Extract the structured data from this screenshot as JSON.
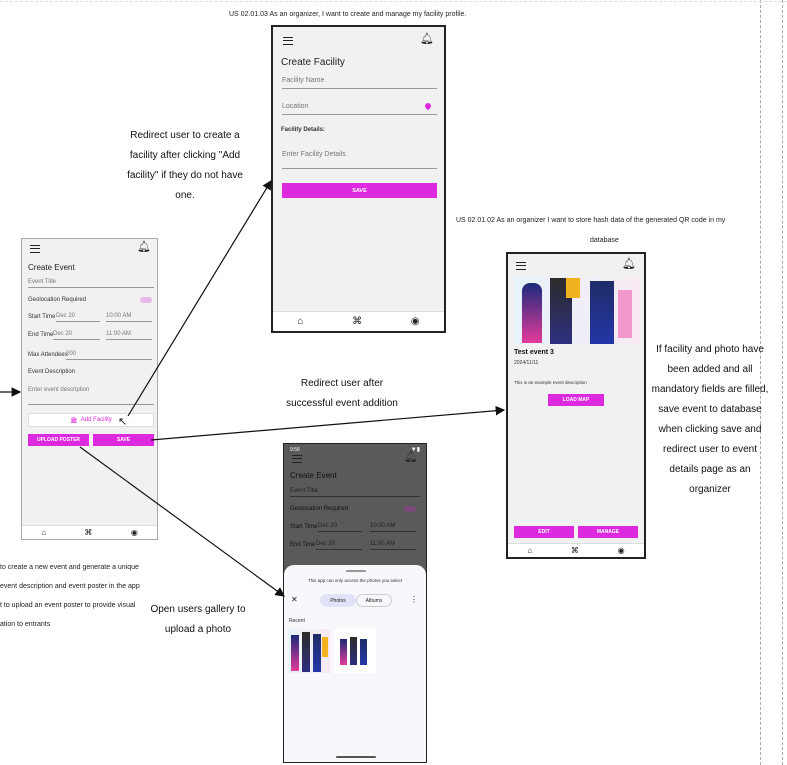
{
  "stories": {
    "facility": "US 02.01.03 As an organizer, I want to create and manage my facility profile.",
    "qr": "US 02.01.02 As an organizer I want to store hash data of the generated QR code in my",
    "qr_line2": "database"
  },
  "notes": {
    "redirect_facility": [
      "Redirect user to create a",
      "facility after clicking \"Add",
      "facility\" if they do not have",
      "one."
    ],
    "redirect_success": [
      "Redirect user after",
      "successful event addition"
    ],
    "gallery": [
      "Open users gallery to",
      "upload a photo"
    ],
    "save_rule": [
      "If facility and photo have",
      "been added and all",
      "mandatory fields are filled,",
      "save event to database",
      "when clicking save and",
      "redirect user to event",
      "details page as an",
      "organizer"
    ],
    "left_desc": [
      "to create a new event and generate a unique",
      "event description and event poster in the app",
      "t to upload an event poster to provide visual",
      "ation to entrants"
    ]
  },
  "facility_screen": {
    "title": "Create Facility",
    "name_placeholder": "Facility Name",
    "location_placeholder": "Location",
    "details_label": "Facility Details:",
    "details_placeholder": "Enter Facility Details",
    "save": "SAVE"
  },
  "event_screen": {
    "title": "Create Event",
    "event_title": "Event Title",
    "geolocation": "Geolocation Required",
    "start_label": "Start Time",
    "start_date": "Dec 20",
    "start_time": "10:00 AM",
    "end_label": "End Time",
    "end_date": "Dec 20",
    "end_time": "11:00 AM",
    "max_label": "Max Attendees",
    "max_value": "200",
    "desc_label": "Event Description",
    "desc_placeholder": "Enter event description",
    "add_facility": "Add Facility",
    "upload": "UPLOAD POSTER",
    "save": "SAVE"
  },
  "details_screen": {
    "event_name": "Test event 3",
    "event_date": "2024/11/11",
    "desc": "This is an example event description",
    "load_map": "LOAD MAP",
    "edit": "EDIT",
    "manage": "MANAGE"
  },
  "gallery_screen": {
    "status_time": "9:56",
    "title": "Create Event",
    "event_title": "Event Title",
    "geolocation": "Geolocation Required",
    "start_label": "Start Time",
    "start_date": "Dec 20",
    "start_time": "10:00 AM",
    "end_label": "End Time",
    "end_date": "Dec 20",
    "end_time": "11:00 AM",
    "access_msg": "This app can only access the photos you select",
    "tab_photos": "Photos",
    "tab_albums": "Albums",
    "recent": "Recent"
  },
  "colors": {
    "accent": "#dd2ae0",
    "dark_overlay": "#5a5a5a"
  }
}
